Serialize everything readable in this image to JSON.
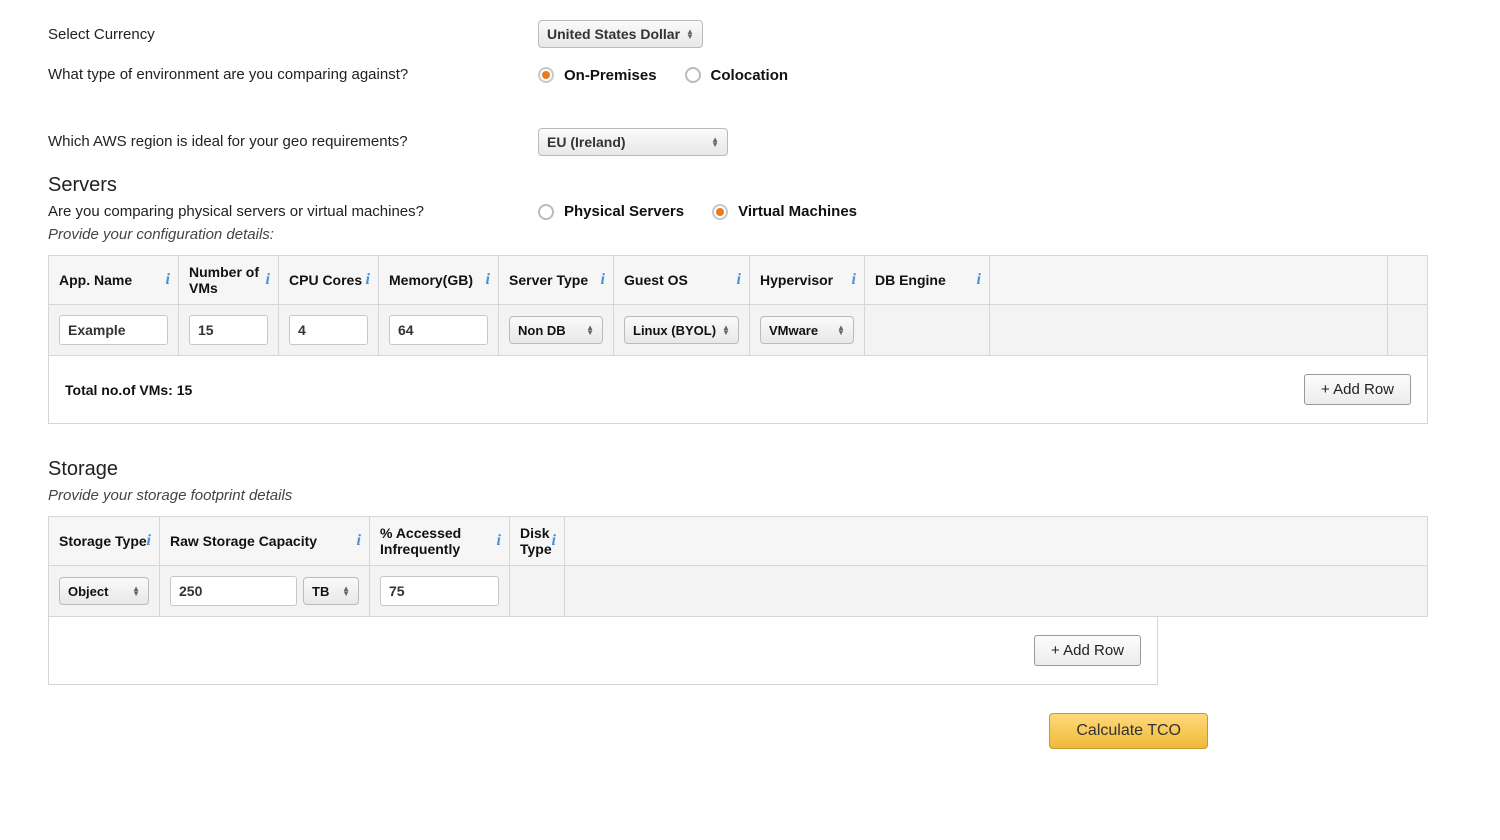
{
  "labels": {
    "select_currency": "Select Currency",
    "env_compare": "What type of environment are you comparing against?",
    "aws_region": "Which AWS region is ideal for your geo requirements?",
    "servers_heading": "Servers",
    "server_type_q": "Are you comparing physical servers or virtual machines?",
    "config_details": "Provide your configuration details:",
    "storage_heading": "Storage",
    "storage_details": "Provide your storage footprint details",
    "total_vms_prefix": "Total no.of VMs:",
    "total_vms_value": "15",
    "add_row": "+ Add Row",
    "calculate": "Calculate TCO"
  },
  "currency": {
    "selected": "United States Dollar"
  },
  "env_radio": {
    "on_premises": "On-Premises",
    "colocation": "Colocation",
    "selected": "on_premises"
  },
  "region": {
    "selected": "EU (Ireland)"
  },
  "server_radio": {
    "physical": "Physical Servers",
    "virtual": "Virtual Machines",
    "selected": "virtual"
  },
  "servers_table": {
    "headers": {
      "app_name": "App. Name",
      "num_vms": "Number of VMs",
      "cpu_cores": "CPU Cores",
      "memory": "Memory(GB)",
      "server_type": "Server Type",
      "guest_os": "Guest OS",
      "hypervisor": "Hypervisor",
      "db_engine": "DB Engine"
    },
    "row": {
      "app_name": "Example",
      "num_vms": "15",
      "cpu_cores": "4",
      "memory": "64",
      "server_type": "Non DB",
      "guest_os": "Linux (BYOL)",
      "hypervisor": "VMware"
    }
  },
  "storage_table": {
    "headers": {
      "storage_type": "Storage Type",
      "raw_capacity": "Raw Storage Capacity",
      "pct_infrequent": "% Accessed Infrequently",
      "disk_type": "Disk Type"
    },
    "row": {
      "storage_type": "Object",
      "capacity_value": "250",
      "capacity_unit": "TB",
      "pct_infrequent": "75"
    }
  }
}
